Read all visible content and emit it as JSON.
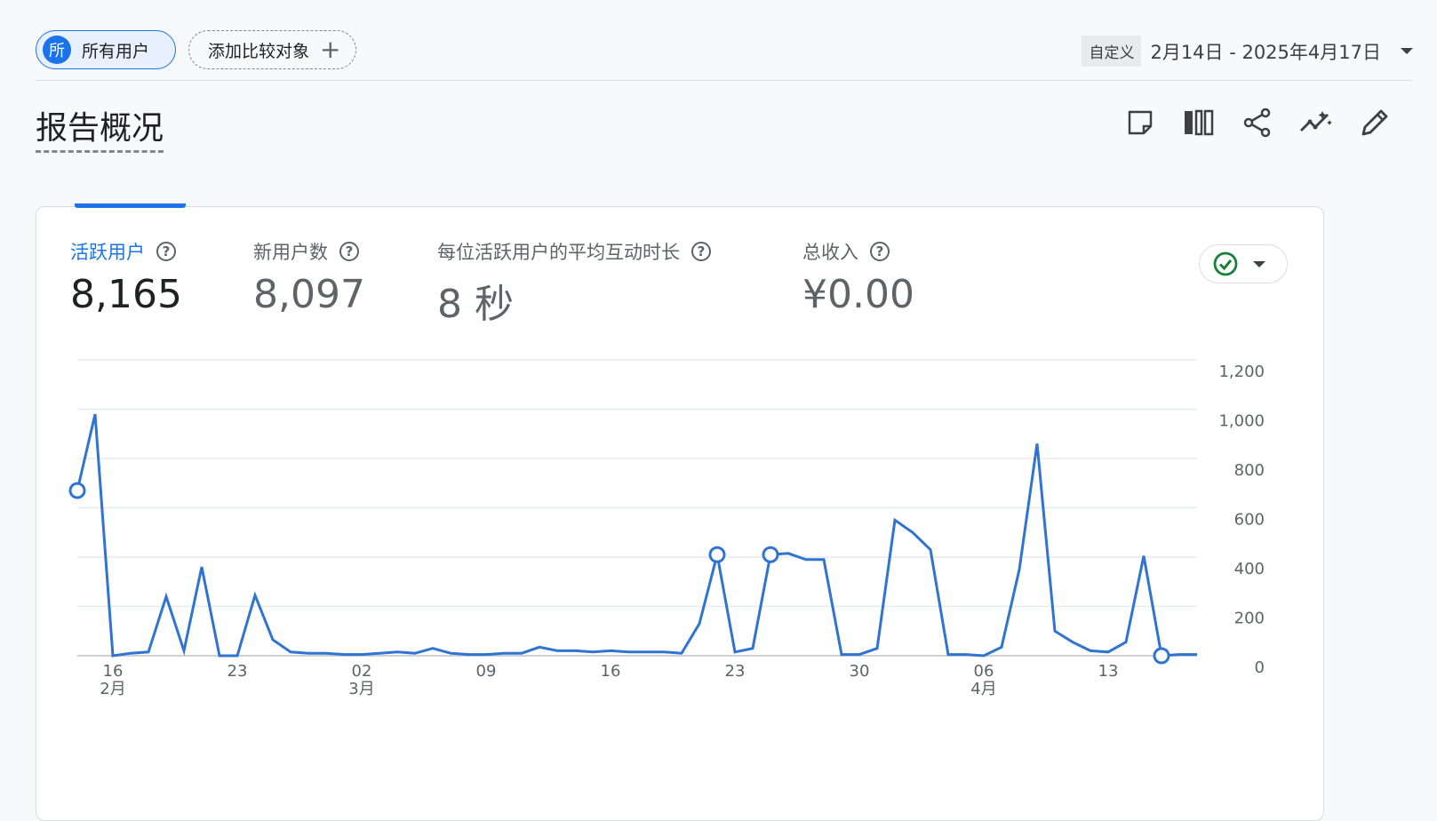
{
  "filters": {
    "users_chip": {
      "avatar": "所",
      "label": "所有用户"
    },
    "compare_chip": {
      "label": "添加比较对象",
      "icon": "plus-icon"
    }
  },
  "date": {
    "tag": "自定义",
    "range": "2月14日 - 2025年4月17日"
  },
  "page_title": "报告概况",
  "actions": [
    "note-icon",
    "compare-columns-icon",
    "share-icon",
    "insights-icon",
    "edit-icon"
  ],
  "metrics": [
    {
      "label": "活跃用户",
      "value": "8,165",
      "active": true
    },
    {
      "label": "新用户数",
      "value": "8,097",
      "active": false
    },
    {
      "label": "每位活跃用户的平均互动时长",
      "value": "8 秒",
      "active": false
    },
    {
      "label": "总收入",
      "value": "¥0.00",
      "active": false
    }
  ],
  "status_icon": "check-circle-icon",
  "colors": {
    "accent": "#1a73e8",
    "line": "#2f74d0",
    "check": "#188038"
  },
  "chart_data": {
    "type": "line",
    "y_ticks": [
      "1,200",
      "1,000",
      "800",
      "600",
      "400",
      "200",
      "0"
    ],
    "ylim": [
      0,
      1200
    ],
    "x_tick_labels": [
      {
        "day": "16",
        "month": "2月"
      },
      {
        "day": "23",
        "month": ""
      },
      {
        "day": "02",
        "month": "3月"
      },
      {
        "day": "09",
        "month": ""
      },
      {
        "day": "16",
        "month": ""
      },
      {
        "day": "23",
        "month": ""
      },
      {
        "day": "30",
        "month": ""
      },
      {
        "day": "06",
        "month": "4月"
      },
      {
        "day": "13",
        "month": ""
      }
    ],
    "series": [
      {
        "x_start": "2025-02-14",
        "values": [
          670,
          980,
          0,
          10,
          15,
          240,
          20,
          360,
          0,
          0,
          245,
          65,
          15,
          10,
          10,
          5,
          5,
          10,
          15,
          10,
          30,
          10,
          5,
          5,
          10,
          10,
          35,
          20,
          20,
          15,
          20,
          15,
          15,
          15,
          10,
          130,
          410,
          15,
          30,
          410,
          415,
          390,
          390,
          5,
          5,
          30,
          550,
          500,
          430,
          5,
          5,
          0,
          35,
          350,
          860,
          100,
          55,
          20,
          15,
          55,
          405,
          0,
          5
        ],
        "markers": [
          "2025-02-14",
          "2025-03-22",
          "2025-03-25",
          "2025-04-16"
        ]
      }
    ]
  }
}
